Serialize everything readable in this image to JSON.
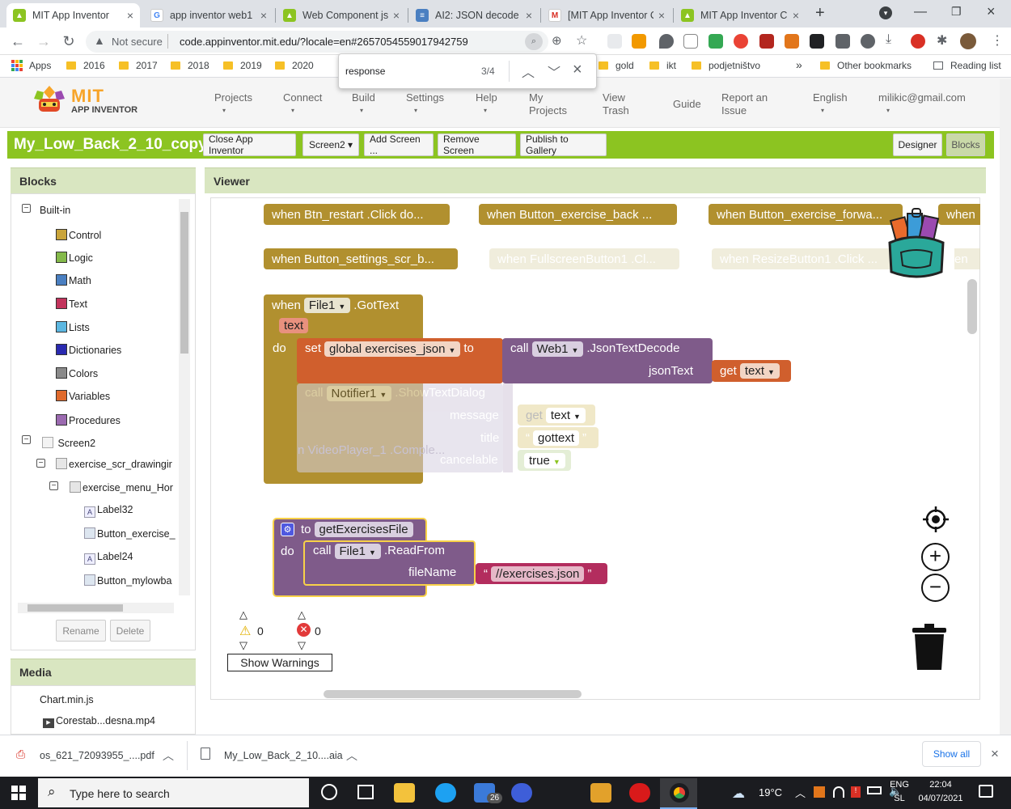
{
  "tabs": [
    {
      "title": "MIT App Inventor",
      "icon": "mit-icon",
      "active": true
    },
    {
      "title": "app inventor web1",
      "icon": "google-icon"
    },
    {
      "title": "Web Component js",
      "icon": "mit-icon"
    },
    {
      "title": "AI2: JSON decode p",
      "icon": "doc-icon"
    },
    {
      "title": "[MIT App Inventor C",
      "icon": "gmail-icon"
    },
    {
      "title": "MIT App Inventor C",
      "icon": "mit-icon"
    }
  ],
  "browser": {
    "security": "Not secure",
    "url": "code.appinventor.mit.edu/?locale=en#2657054559017942759"
  },
  "bookmarks": {
    "apps": "Apps",
    "items": [
      "2016",
      "2017",
      "2018",
      "2019",
      "2020",
      "gold",
      "ikt",
      "podjetništvo"
    ],
    "more": "»",
    "other": "Other bookmarks",
    "reading": "Reading list"
  },
  "find": {
    "query": "response",
    "count": "3/4"
  },
  "app": {
    "logo_mit": "MIT",
    "logo_sub": "APP INVENTOR",
    "menu": [
      "Projects",
      "Connect",
      "Build",
      "Settings",
      "Help",
      "My Projects",
      "View Trash",
      "Guide",
      "Report an Issue",
      "English",
      "milikic@gmail.com"
    ],
    "project_name": "My_Low_Back_2_10_copy",
    "buttons": [
      "Close App Inventor",
      "Screen2 ▾",
      "Add Screen ...",
      "Remove Screen",
      "Publish to Gallery"
    ],
    "designer": "Designer",
    "blocks_btn": "Blocks"
  },
  "blocks_panel": {
    "title": "Blocks",
    "builtin": "Built-in",
    "categories": [
      {
        "name": "Control",
        "color": "#c9a43a"
      },
      {
        "name": "Logic",
        "color": "#84b94a"
      },
      {
        "name": "Math",
        "color": "#4a7fc1"
      },
      {
        "name": "Text",
        "color": "#c2335c"
      },
      {
        "name": "Lists",
        "color": "#5cb7e1"
      },
      {
        "name": "Dictionaries",
        "color": "#2a2ab0"
      },
      {
        "name": "Colors",
        "color": "#8a8a8a"
      },
      {
        "name": "Variables",
        "color": "#e06a2c"
      },
      {
        "name": "Procedures",
        "color": "#9b6ab0"
      }
    ],
    "screen": "Screen2",
    "components": [
      "exercise_scr_drawingir",
      "exercise_menu_Hor",
      "Label32",
      "Button_exercise_",
      "Label24",
      "Button_mylowba"
    ],
    "rename": "Rename",
    "delete": "Delete"
  },
  "media": {
    "title": "Media",
    "items": [
      "Chart.min.js",
      "Corestab...desna.mp4"
    ]
  },
  "viewer": {
    "title": "Viewer",
    "events_row1": [
      "when  Btn_restart .Click do...",
      "when  Button_exercise_back ...",
      "when  Button_exercise_forwa...",
      "when"
    ],
    "events_row2": [
      "when  Button_settings_scr_b...",
      "when  FullscreenButton1 .Cl...",
      "when  ResizeButton1 .Click ...",
      "en"
    ],
    "gottext": {
      "when": "when",
      "component": "File1",
      "event": ".GotText",
      "param": "text",
      "do": "do",
      "set": "set",
      "var": "global exercises_json",
      "to": "to",
      "call": "call",
      "web": "Web1",
      "method": ".JsonTextDecode",
      "jsonText": "jsonText",
      "get": "get",
      "get_var": "text",
      "notifier": "Notifier1",
      "notifier_method": ".ShowTextDialog",
      "message": "message",
      "msg_get": "get",
      "msg_var": "text",
      "title": "title",
      "title_val": "gottext",
      "cancelable": "cancelable",
      "cancel_val": "true",
      "ghost": "n  VideoPlayer_1 .Comple..."
    },
    "proc": {
      "to": "to",
      "name": "getExercisesFile",
      "do": "do",
      "call": "call",
      "component": "File1",
      "method": ".ReadFrom",
      "fileName": "fileName",
      "value": "//exercises.json"
    },
    "warnings": {
      "warn_count": "0",
      "error_count": "0",
      "show": "Show Warnings"
    }
  },
  "downloads": [
    {
      "name": "os_621_72093955_....pdf",
      "icon": "pdf-icon"
    },
    {
      "name": "My_Low_Back_2_10....aia",
      "icon": "file-icon"
    }
  ],
  "downloads_show_all": "Show all",
  "taskbar": {
    "search": "Type here to search",
    "temp": "19°C",
    "lang1": "ENG",
    "lang2": "SL",
    "time": "22:04",
    "date": "04/07/2021",
    "mail_badge": "26"
  }
}
